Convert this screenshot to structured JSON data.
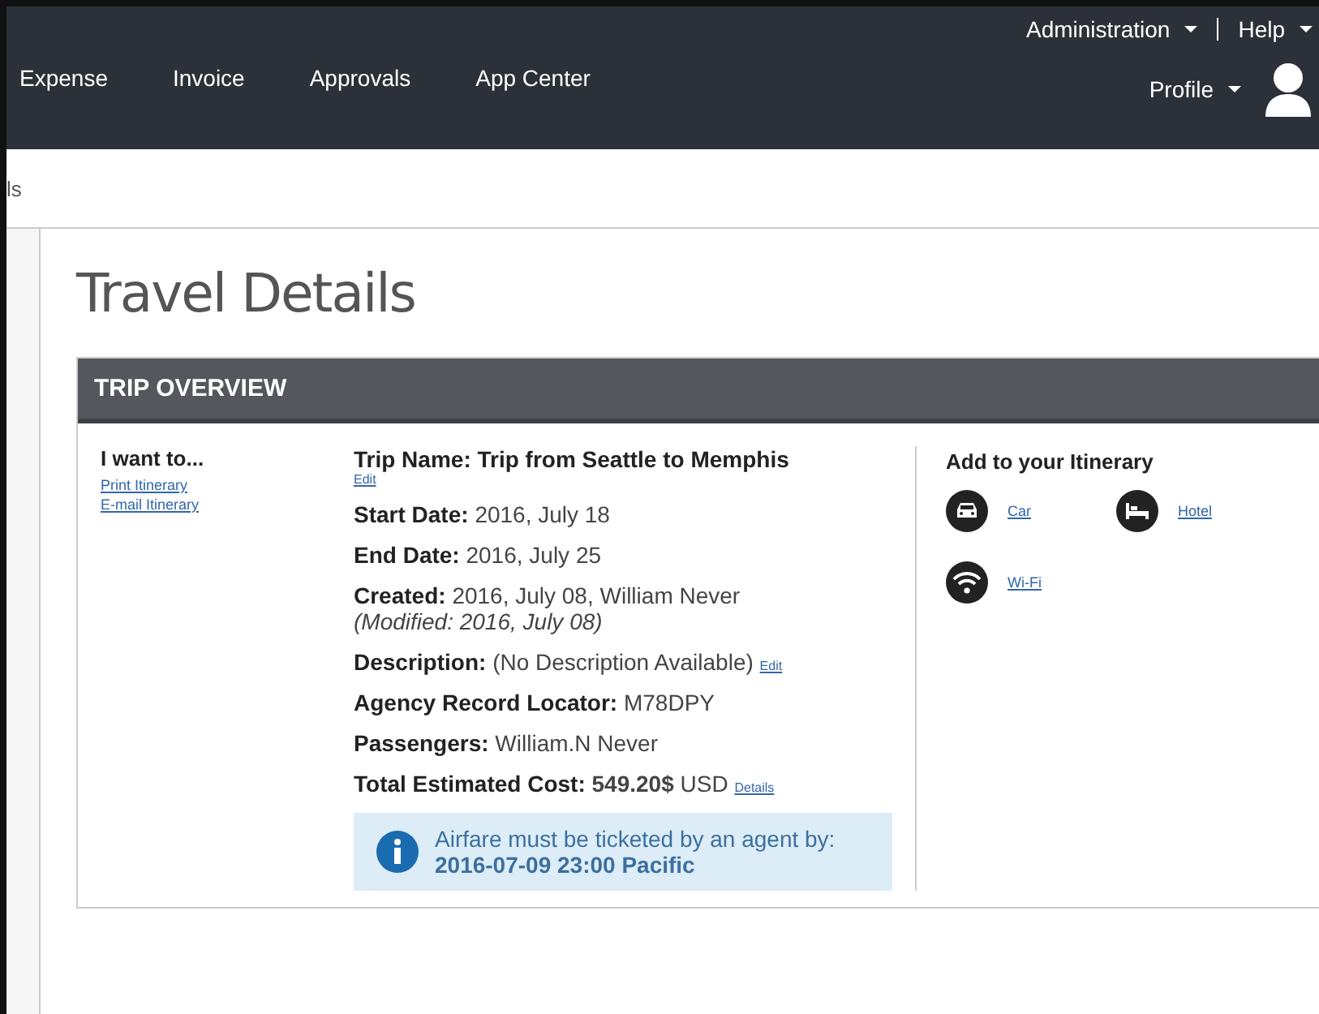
{
  "nav": {
    "items": [
      "Expense",
      "Invoice",
      "Approvals",
      "App Center"
    ],
    "top_links": [
      "Administration",
      "Help"
    ],
    "profile": "Profile"
  },
  "breadcrumb": "ls",
  "page_title": "Travel Details",
  "section_title": "TRIP OVERVIEW",
  "actions": {
    "heading": "I want to...",
    "links": [
      "Print Itinerary",
      "E-mail Itinerary"
    ]
  },
  "trip": {
    "name_label": "Trip Name:",
    "name": "Trip from Seattle to Memphis",
    "name_edit": "Edit",
    "fields": [
      {
        "label": "Start Date:",
        "value": "2016, July 18"
      },
      {
        "label": "End Date:",
        "value": "2016, July 25"
      },
      {
        "label": "Created:",
        "value": "2016, July 08, William Never",
        "note": "(Modified: 2016, July 08)"
      },
      {
        "label": "Description:",
        "value": "(No Description Available)",
        "link": "Edit"
      },
      {
        "label": "Agency Record Locator:",
        "value": "M78DPY"
      },
      {
        "label": "Passengers:",
        "value": "William.N Never"
      },
      {
        "label": "Total Estimated Cost:",
        "value": "**549.20$** USD",
        "link": "Details"
      }
    ],
    "notice": "Airfare must be ticketed by an agent by: **2016-07-09 23:00 Pacific**"
  },
  "add": {
    "heading": "Add to your Itinerary",
    "items": [
      {
        "kind": "car",
        "label": "Car"
      },
      {
        "kind": "hotel",
        "label": "Hotel"
      },
      {
        "kind": "wifi",
        "label": "Wi-Fi"
      }
    ]
  }
}
